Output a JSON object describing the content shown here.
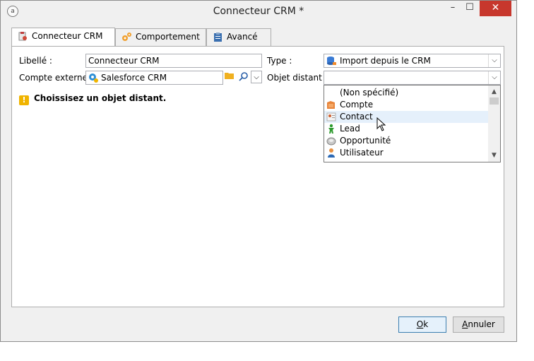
{
  "window": {
    "title": "Connecteur CRM *",
    "minimize": "–",
    "maximize": "☐",
    "close": "✕"
  },
  "tabs": [
    {
      "label": "Connecteur CRM",
      "icon": "crm-connector-icon"
    },
    {
      "label": "Comportement",
      "icon": "gears-icon"
    },
    {
      "label": "Avancé",
      "icon": "clipboard-icon"
    }
  ],
  "form": {
    "libelle_label": "Libellé :",
    "libelle_value": "Connecteur CRM",
    "type_label": "Type :",
    "type_value": "Import depuis le CRM",
    "compte_label": "Compte externe :",
    "compte_value": "Salesforce CRM",
    "objet_label": "Objet distant :",
    "objet_value": ""
  },
  "warning": "Choissisez un objet distant.",
  "dropdown": {
    "items": [
      {
        "label": "(Non spécifié)",
        "icon": ""
      },
      {
        "label": "Compte",
        "icon": "account-icon"
      },
      {
        "label": "Contact",
        "icon": "contact-icon"
      },
      {
        "label": "Lead",
        "icon": "lead-icon"
      },
      {
        "label": "Opportunité",
        "icon": "opportunity-icon"
      },
      {
        "label": "Utilisateur",
        "icon": "user-icon"
      }
    ],
    "hovered": "Contact"
  },
  "buttons": {
    "ok_first": "O",
    "ok_rest": "k",
    "cancel_first": "A",
    "cancel_rest": "nnuler"
  },
  "colors": {
    "close_button": "#c7372d",
    "warning": "#f0b400",
    "hover": "#e5f0fb"
  }
}
